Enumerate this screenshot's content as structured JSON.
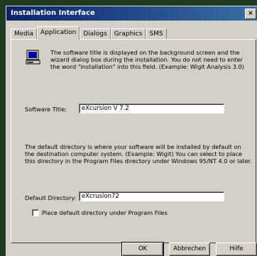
{
  "window": {
    "title": "Installation Interface"
  },
  "tabs": [
    "Media",
    "Application",
    "Dialogs",
    "Graphics",
    "SMS"
  ],
  "active_tab": "Application",
  "software_title": {
    "description": "The software title is displayed on the background screen and the wizard dialog box during the installation. You do not need to enter the word \"installation\" into this field. (Example: Wigit Analysis 3.0)",
    "label": "Software Title:",
    "value": "eXcursion V 7.2"
  },
  "default_directory": {
    "description": "The default directory is where your software will be installed by default on the destination computer system. (Example: Wigit) You can select to place this directory in the Program Files directory under Windows 95/NT 4.0 or later.",
    "label": "Default Directory:",
    "value": "eXcrusion72"
  },
  "checkbox": {
    "label": "Place default directory under Program Files",
    "checked": false
  },
  "buttons": {
    "ok": "OK",
    "cancel": "Abbrechen",
    "help": "Hilfe"
  }
}
